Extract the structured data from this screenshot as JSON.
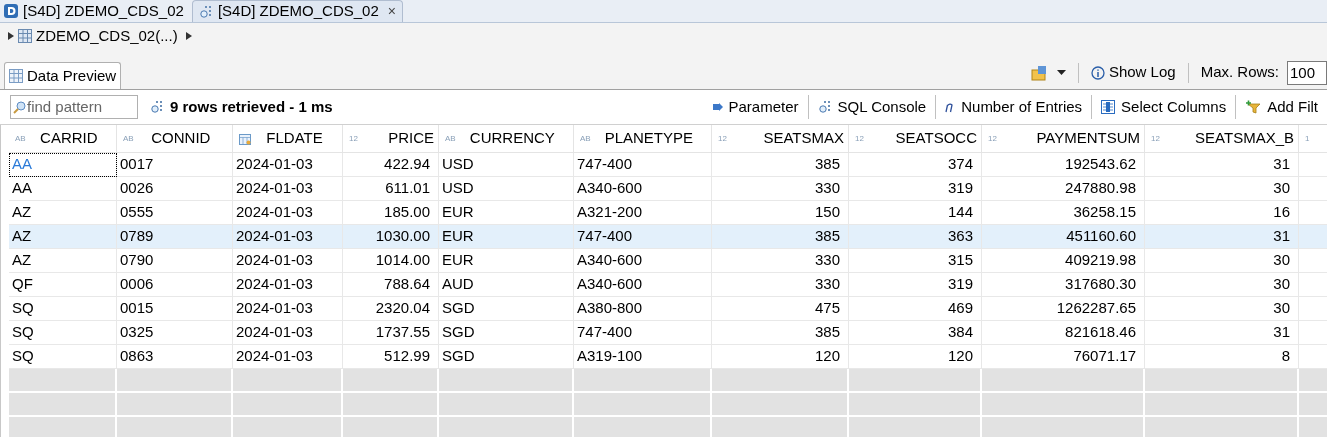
{
  "editor_tabs": [
    {
      "label": "[S4D] ZDEMO_CDS_02",
      "selected": false
    },
    {
      "label": "[S4D] ZDEMO_CDS_02",
      "selected": true,
      "close": "×"
    }
  ],
  "breadcrumb": {
    "label": "ZDEMO_CDS_02(...)"
  },
  "view_tab": {
    "label": "Data Preview",
    "selected": true
  },
  "view_toolbar": {
    "show_log": "Show Log",
    "max_rows_label": "Max. Rows:",
    "max_rows": "100"
  },
  "search": {
    "placeholder": "find pattern"
  },
  "status": "9 rows retrieved - 1 ms",
  "actions": [
    {
      "kind": "parameter",
      "label": "Parameter"
    },
    {
      "kind": "sql",
      "label": "SQL Console"
    },
    {
      "kind": "entries",
      "label": "Number of Entries"
    },
    {
      "kind": "columns",
      "label": "Select Columns"
    },
    {
      "kind": "filter",
      "label": "Add Filt"
    }
  ],
  "table": {
    "columns": [
      {
        "label": "CARRID",
        "kind": "text",
        "badge": "AB"
      },
      {
        "label": "CONNID",
        "kind": "text",
        "badge": "AB"
      },
      {
        "label": "FLDATE",
        "kind": "date"
      },
      {
        "label": "PRICE",
        "kind": "number",
        "badge": "12"
      },
      {
        "label": "CURRENCY",
        "kind": "text",
        "badge": "AB"
      },
      {
        "label": "PLANETYPE",
        "kind": "text",
        "badge": "AB"
      },
      {
        "label": "SEATSMAX",
        "kind": "number",
        "badge": "12"
      },
      {
        "label": "SEATSOCC",
        "kind": "number",
        "badge": "12"
      },
      {
        "label": "PAYMENTSUM",
        "kind": "number",
        "badge": "12"
      },
      {
        "label": "SEATSMAX_B",
        "kind": "number",
        "badge": "12"
      },
      {
        "kind": "number",
        "badge": "1"
      }
    ],
    "rows": [
      {
        "selected": false,
        "focused": true,
        "cells": [
          "AA",
          "0017",
          "2024-01-03",
          "422.94",
          "USD",
          "747-400",
          "385",
          "374",
          "192543.62",
          "31"
        ]
      },
      {
        "selected": false,
        "focused": false,
        "cells": [
          "AA",
          "0026",
          "2024-01-03",
          "611.01",
          "USD",
          "A340-600",
          "330",
          "319",
          "247880.98",
          "30"
        ]
      },
      {
        "selected": false,
        "focused": false,
        "cells": [
          "AZ",
          "0555",
          "2024-01-03",
          "185.00",
          "EUR",
          "A321-200",
          "150",
          "144",
          "36258.15",
          "16"
        ]
      },
      {
        "selected": true,
        "focused": false,
        "cells": [
          "AZ",
          "0789",
          "2024-01-03",
          "1030.00",
          "EUR",
          "747-400",
          "385",
          "363",
          "451160.60",
          "31"
        ]
      },
      {
        "selected": false,
        "focused": false,
        "cells": [
          "AZ",
          "0790",
          "2024-01-03",
          "1014.00",
          "EUR",
          "A340-600",
          "330",
          "315",
          "409219.98",
          "30"
        ]
      },
      {
        "selected": false,
        "focused": false,
        "cells": [
          "QF",
          "0006",
          "2024-01-03",
          "788.64",
          "AUD",
          "A340-600",
          "330",
          "319",
          "317680.30",
          "30"
        ]
      },
      {
        "selected": false,
        "focused": false,
        "cells": [
          "SQ",
          "0015",
          "2024-01-03",
          "2320.04",
          "SGD",
          "A380-800",
          "475",
          "469",
          "1262287.65",
          "30"
        ]
      },
      {
        "selected": false,
        "focused": false,
        "cells": [
          "SQ",
          "0325",
          "2024-01-03",
          "1737.55",
          "SGD",
          "747-400",
          "385",
          "384",
          "821618.46",
          "31"
        ]
      },
      {
        "selected": false,
        "focused": false,
        "cells": [
          "SQ",
          "0863",
          "2024-01-03",
          "512.99",
          "SGD",
          "A319-100",
          "120",
          "120",
          "76071.17",
          "8"
        ]
      }
    ]
  }
}
